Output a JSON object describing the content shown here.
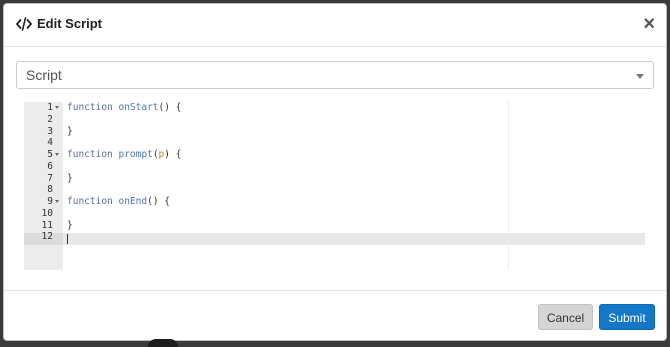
{
  "dialog": {
    "title": "Edit Script",
    "title_icon": "code-icon",
    "close_icon": "close-icon",
    "close_label": "×"
  },
  "select": {
    "value": "Script",
    "caret_icon": "chevron-down-icon"
  },
  "editor": {
    "lines": [
      {
        "num": "1",
        "fold": true,
        "tokens": [
          {
            "t": "function ",
            "c": "kw"
          },
          {
            "t": "onStart",
            "c": "fn"
          },
          {
            "t": "() {",
            "c": ""
          }
        ]
      },
      {
        "num": "2",
        "fold": false,
        "tokens": []
      },
      {
        "num": "3",
        "fold": false,
        "tokens": [
          {
            "t": "}",
            "c": ""
          }
        ]
      },
      {
        "num": "4",
        "fold": false,
        "tokens": []
      },
      {
        "num": "5",
        "fold": true,
        "tokens": [
          {
            "t": "function ",
            "c": "kw"
          },
          {
            "t": "prompt",
            "c": "fn"
          },
          {
            "t": "(",
            "c": ""
          },
          {
            "t": "p",
            "c": "param"
          },
          {
            "t": ") {",
            "c": ""
          }
        ]
      },
      {
        "num": "6",
        "fold": false,
        "tokens": []
      },
      {
        "num": "7",
        "fold": false,
        "tokens": [
          {
            "t": "}",
            "c": ""
          }
        ]
      },
      {
        "num": "8",
        "fold": false,
        "tokens": []
      },
      {
        "num": "9",
        "fold": true,
        "tokens": [
          {
            "t": "function ",
            "c": "kw"
          },
          {
            "t": "onEnd",
            "c": "fn"
          },
          {
            "t": "() {",
            "c": ""
          }
        ]
      },
      {
        "num": "10",
        "fold": false,
        "tokens": []
      },
      {
        "num": "11",
        "fold": false,
        "tokens": [
          {
            "t": "}",
            "c": ""
          }
        ]
      },
      {
        "num": "12",
        "fold": false,
        "tokens": []
      }
    ],
    "active_line": 12
  },
  "footer": {
    "cancel_label": "Cancel",
    "submit_label": "Submit"
  },
  "colors": {
    "submit_bg": "#1577c7",
    "cancel_bg": "#d5d5d5",
    "keyword": "#5a6fa0",
    "param": "#c0892b"
  }
}
